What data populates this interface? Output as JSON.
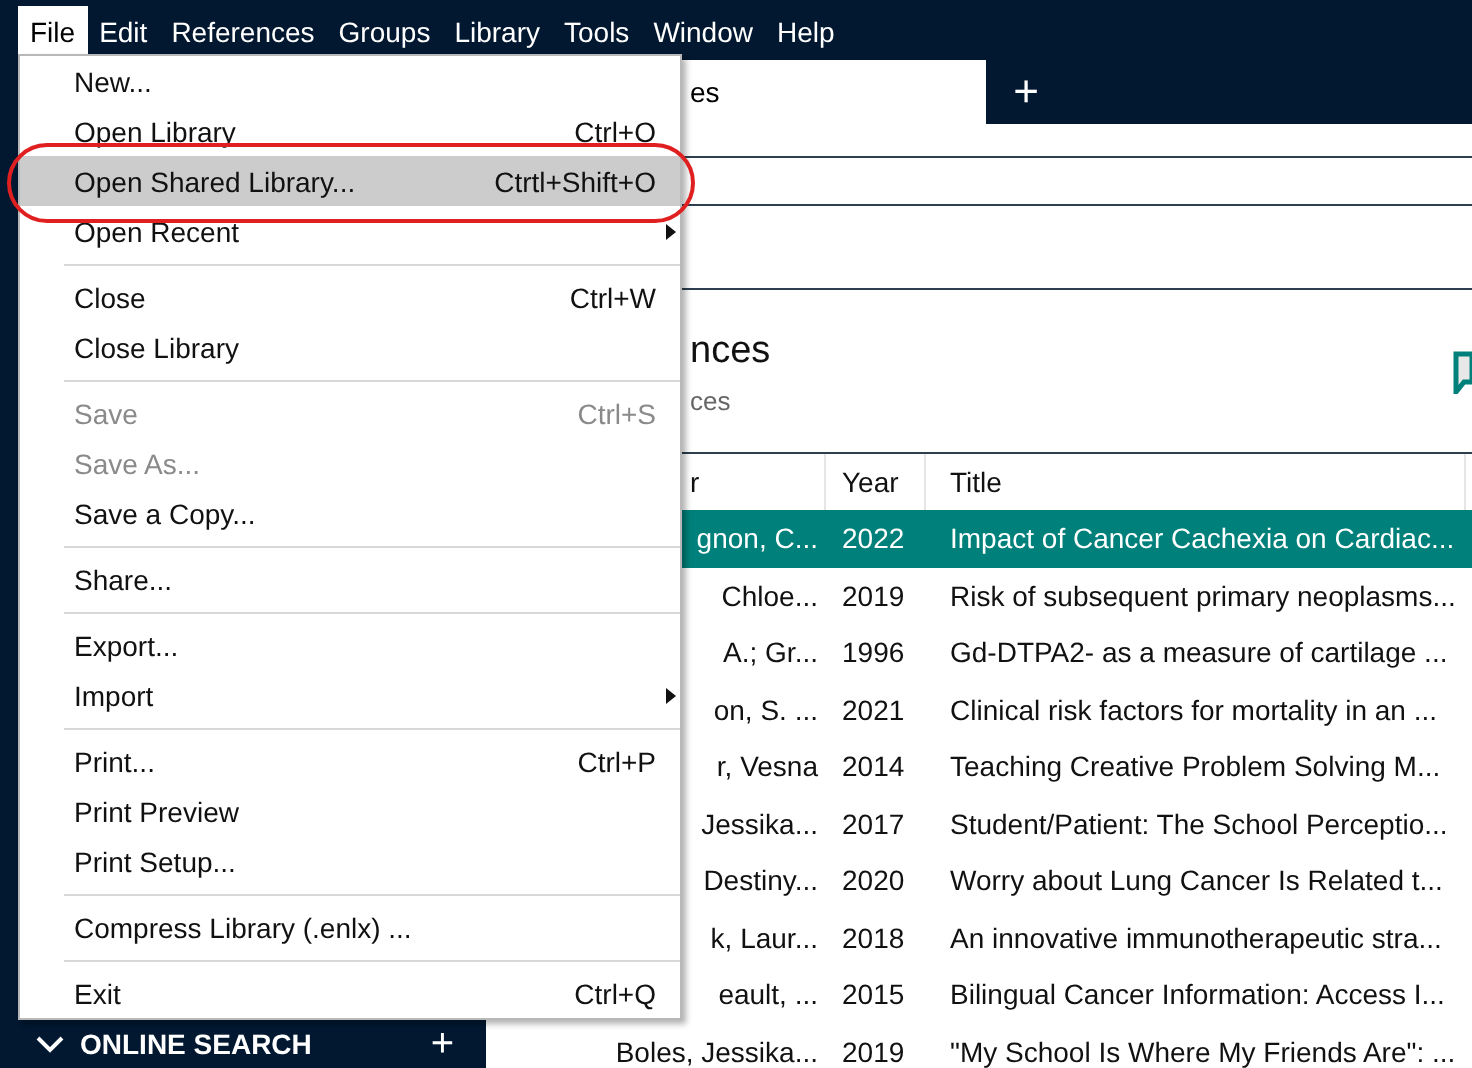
{
  "menu_bar": [
    {
      "label": "File",
      "selected": true
    },
    {
      "label": "Edit",
      "selected": false
    },
    {
      "label": "References",
      "selected": false
    },
    {
      "label": "Groups",
      "selected": false
    },
    {
      "label": "Library",
      "selected": false
    },
    {
      "label": "Tools",
      "selected": false
    },
    {
      "label": "Window",
      "selected": false
    },
    {
      "label": "Help",
      "selected": false
    }
  ],
  "tab": {
    "label": "es"
  },
  "new_tab": "+",
  "heading": {
    "title": "nces",
    "subtitle": "ces"
  },
  "table": {
    "columns": [
      "r",
      "Year",
      "Title"
    ],
    "rows": [
      {
        "author": "gnon, C...",
        "year": "2022",
        "title": "Impact of Cancer Cachexia on Cardiac...",
        "selected": true
      },
      {
        "author": "Chloe...",
        "year": "2019",
        "title": "Risk of subsequent primary neoplasms...",
        "selected": false
      },
      {
        "author": "A.; Gr...",
        "year": "1996",
        "title": "Gd-DTPA2- as a measure of cartilage ...",
        "selected": false
      },
      {
        "author": "on, S. ...",
        "year": "2021",
        "title": "Clinical risk factors for mortality in an ...",
        "selected": false
      },
      {
        "author": "r, Vesna",
        "year": "2014",
        "title": "Teaching Creative Problem Solving M...",
        "selected": false
      },
      {
        "author": "Jessika...",
        "year": "2017",
        "title": "Student/Patient: The School Perceptio...",
        "selected": false
      },
      {
        "author": "Destiny...",
        "year": "2020",
        "title": "Worry about Lung Cancer Is Related t...",
        "selected": false
      },
      {
        "author": "k, Laur...",
        "year": "2018",
        "title": "An innovative immunotherapeutic stra...",
        "selected": false
      },
      {
        "author": "eault, ...",
        "year": "2015",
        "title": "Bilingual Cancer Information: Access I...",
        "selected": false
      },
      {
        "author": "Boles, Jessika...",
        "year": "2019",
        "title": "\"My School Is Where My Friends Are\": ...",
        "selected": false
      }
    ]
  },
  "sidebar": {
    "section": "ONLINE SEARCH",
    "add": "+"
  },
  "file_menu": [
    [
      {
        "label": "New...",
        "disabled": false,
        "selected": false,
        "submenu": false
      },
      {
        "label": "Open Library",
        "shortcut": "Ctrl+O",
        "disabled": false,
        "selected": false,
        "submenu": false
      },
      {
        "label": "Open Shared Library...",
        "shortcut": "Ctrtl+Shift+O",
        "disabled": false,
        "selected": true,
        "submenu": false
      },
      {
        "label": "Open Recent",
        "disabled": false,
        "selected": false,
        "submenu": true
      }
    ],
    [
      {
        "label": "Close",
        "shortcut": "Ctrl+W",
        "disabled": false,
        "selected": false,
        "submenu": false
      },
      {
        "label": "Close Library",
        "disabled": false,
        "selected": false,
        "submenu": false
      }
    ],
    [
      {
        "label": "Save",
        "shortcut": "Ctrl+S",
        "disabled": true,
        "selected": false,
        "submenu": false
      },
      {
        "label": "Save As...",
        "disabled": true,
        "selected": false,
        "submenu": false
      },
      {
        "label": "Save a Copy...",
        "disabled": false,
        "selected": false,
        "submenu": false
      }
    ],
    [
      {
        "label": "Share...",
        "disabled": false,
        "selected": false,
        "submenu": false
      }
    ],
    [
      {
        "label": "Export...",
        "disabled": false,
        "selected": false,
        "submenu": false
      },
      {
        "label": "Import",
        "disabled": false,
        "selected": false,
        "submenu": true
      }
    ],
    [
      {
        "label": "Print...",
        "shortcut": "Ctrl+P",
        "disabled": false,
        "selected": false,
        "submenu": false
      },
      {
        "label": "Print Preview",
        "disabled": false,
        "selected": false,
        "submenu": false
      },
      {
        "label": "Print Setup...",
        "disabled": false,
        "selected": false,
        "submenu": false
      }
    ],
    [
      {
        "label": "Compress Library (.enlx) ...",
        "disabled": false,
        "selected": false,
        "submenu": false
      }
    ],
    [
      {
        "label": "Exit",
        "shortcut": "Ctrl+Q",
        "disabled": false,
        "selected": false,
        "submenu": false
      }
    ]
  ]
}
